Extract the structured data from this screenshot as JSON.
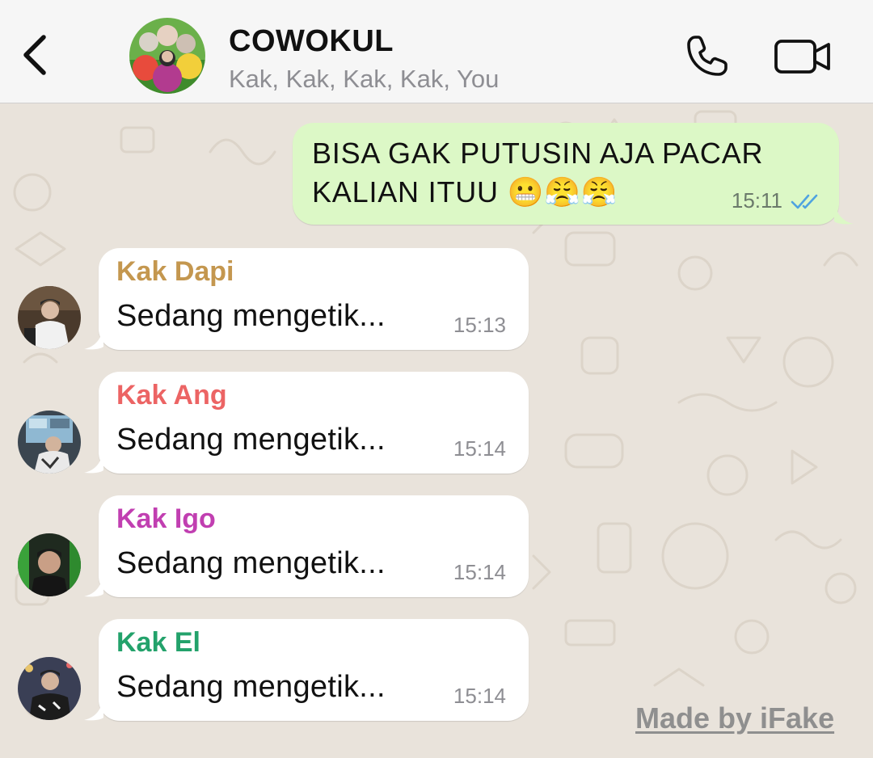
{
  "header": {
    "title": "COWOKUL",
    "members": "Kak, Kak, Kak, Kak, You",
    "icons": {
      "back": "chevron-left-icon",
      "call": "phone-icon",
      "video": "video-camera-icon"
    }
  },
  "messages": [
    {
      "direction": "outgoing",
      "text": "BISA GAK PUTUSIN AJA PACAR KALIAN ITUU 😬😤😤",
      "time": "15:11",
      "status": "read"
    },
    {
      "direction": "incoming",
      "sender": "Kak Dapi",
      "sender_color": "#c4974f",
      "text": "Sedang mengetik...",
      "time": "15:13"
    },
    {
      "direction": "incoming",
      "sender": "Kak Ang",
      "sender_color": "#ec6464",
      "text": "Sedang mengetik...",
      "time": "15:14"
    },
    {
      "direction": "incoming",
      "sender": "Kak Igo",
      "sender_color": "#c13fb1",
      "text": "Sedang mengetik...",
      "time": "15:14"
    },
    {
      "direction": "incoming",
      "sender": "Kak El",
      "sender_color": "#23a26b",
      "text": "Sedang mengetik...",
      "time": "15:14"
    }
  ],
  "colors": {
    "outgoing_bubble": "#dcf8c6",
    "incoming_bubble": "#ffffff",
    "read_ticks": "#4fa3e0"
  },
  "watermark": "Made by iFake"
}
